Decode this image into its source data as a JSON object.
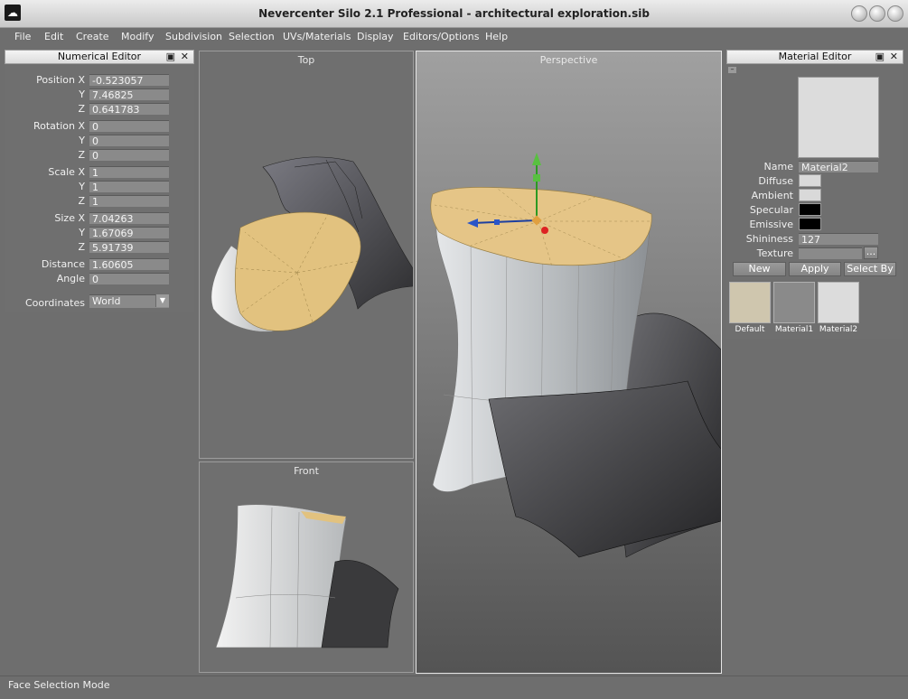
{
  "window": {
    "title": "Nevercenter Silo 2.1 Professional - architectural exploration.sib",
    "app_icon": "silo-app-icon"
  },
  "menu": [
    "File",
    "Edit",
    "Create",
    "Modify",
    "Subdivision",
    "Selection",
    "UVs/Materials",
    "Display",
    "Editors/Options",
    "Help"
  ],
  "numerical_editor": {
    "title": "Numerical Editor",
    "position": {
      "x_label": "Position X",
      "x": "-0.523057",
      "y_label": "Y",
      "y": "7.46825",
      "z_label": "Z",
      "z": "0.641783"
    },
    "rotation": {
      "x_label": "Rotation X",
      "x": "0",
      "y_label": "Y",
      "y": "0",
      "z_label": "Z",
      "z": "0"
    },
    "scale": {
      "x_label": "Scale X",
      "x": "1",
      "y_label": "Y",
      "y": "1",
      "z_label": "Z",
      "z": "1"
    },
    "size": {
      "x_label": "Size X",
      "x": "7.04263",
      "y_label": "Y",
      "y": "1.67069",
      "z_label": "Z",
      "z": "5.91739"
    },
    "distance_label": "Distance",
    "distance": "1.60605",
    "angle_label": "Angle",
    "angle": "0",
    "coordinates_label": "Coordinates",
    "coordinates": "World"
  },
  "viewports": {
    "top": "Top",
    "front": "Front",
    "perspective": "Perspective"
  },
  "material_editor": {
    "title": "Material Editor",
    "collapse_glyph": "–",
    "name_label": "Name",
    "name": "Material2",
    "diffuse_label": "Diffuse",
    "diffuse_color": "#d9d9d9",
    "ambient_label": "Ambient",
    "ambient_color": "#d9d9d9",
    "specular_label": "Specular",
    "specular_color": "#000000",
    "emissive_label": "Emissive",
    "emissive_color": "#000000",
    "shininess_label": "Shininess",
    "shininess": "127",
    "texture_label": "Texture",
    "texture": "",
    "browse_label": "...",
    "buttons": {
      "new": "New",
      "apply": "Apply",
      "select_by": "Select By"
    },
    "materials": [
      {
        "name": "Default",
        "color": "#cfc6ae"
      },
      {
        "name": "Material1",
        "color": "#8a8a8a"
      },
      {
        "name": "Material2",
        "color": "#dcdcdc"
      }
    ]
  },
  "status": "Face Selection Mode",
  "colors": {
    "accent_face": "#e5c587",
    "ui_background": "#6e6e6e"
  }
}
